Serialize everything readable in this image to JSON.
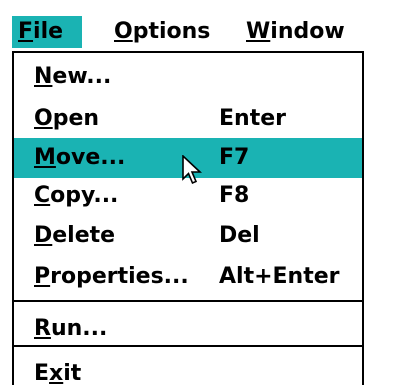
{
  "menubar": {
    "file": {
      "prefix": "",
      "key": "F",
      "suffix": "ile"
    },
    "options": {
      "prefix": "",
      "key": "O",
      "suffix": "ptions"
    },
    "window": {
      "prefix": "",
      "key": "W",
      "suffix": "indow"
    }
  },
  "menu": {
    "new": {
      "prefix": "",
      "key": "N",
      "suffix": "ew...",
      "shortcut": ""
    },
    "open": {
      "prefix": "",
      "key": "O",
      "suffix": "pen",
      "shortcut": "Enter"
    },
    "move": {
      "prefix": "",
      "key": "M",
      "suffix": "ove...",
      "shortcut": "F7"
    },
    "copy": {
      "prefix": "",
      "key": "C",
      "suffix": "opy...",
      "shortcut": "F8"
    },
    "delete": {
      "prefix": "",
      "key": "D",
      "suffix": "elete",
      "shortcut": "Del"
    },
    "properties": {
      "prefix": "",
      "key": "P",
      "suffix": "roperties...",
      "shortcut": "Alt+Enter"
    },
    "run": {
      "prefix": "",
      "key": "R",
      "suffix": "un...",
      "shortcut": ""
    },
    "exit": {
      "prefix": "E",
      "key": "x",
      "suffix": "it",
      "shortcut": ""
    }
  },
  "selected_item": "move",
  "cursor_icon": "arrow-pointer",
  "colors": {
    "highlight": "#1ab3b3",
    "text": "#000000",
    "background": "#ffffff"
  }
}
